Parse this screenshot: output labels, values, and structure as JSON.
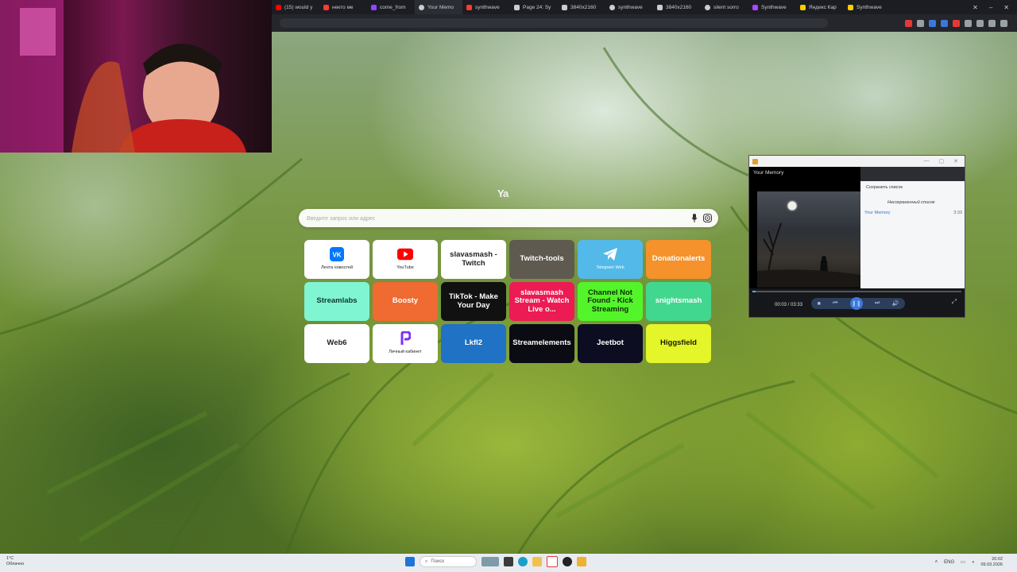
{
  "browser": {
    "tabs": [
      {
        "title": "(15) would y",
        "icon": "youtube-icon",
        "color": "#ff0000"
      },
      {
        "title": "некто ме",
        "icon": "yandex-music-icon",
        "color": "#ff3b30"
      },
      {
        "title": "come_from",
        "icon": "twitch-icon",
        "color": "#9146ff"
      },
      {
        "title": "Your Memo",
        "icon": "globe-icon",
        "color": "#cccccc"
      },
      {
        "title": "synthwave",
        "icon": "yandex-music-icon",
        "color": "#ff3b30"
      },
      {
        "title": "Page 24: Sy",
        "icon": "page-icon",
        "color": "#cccccc"
      },
      {
        "title": "3840x2160",
        "icon": "image-icon",
        "color": "#cccccc"
      },
      {
        "title": "synthwave",
        "icon": "globe-icon",
        "color": "#cccccc"
      },
      {
        "title": "3840x2160",
        "icon": "image-icon",
        "color": "#cccccc"
      },
      {
        "title": "silent sorro",
        "icon": "globe-icon",
        "color": "#cccccc"
      },
      {
        "title": "Synthwave",
        "icon": "synthwave-icon",
        "color": "#b046ff"
      },
      {
        "title": "Яндекс Кар",
        "icon": "yandex-icon",
        "color": "#ffcc00"
      },
      {
        "title": "Synthwave",
        "icon": "yandex-icon",
        "color": "#ffcc00"
      }
    ]
  },
  "search": {
    "logo": "Ya",
    "placeholder": "Введите запрос или адрес"
  },
  "tiles": [
    {
      "label": "",
      "caption": "Лента новостей",
      "icon": "vk-icon",
      "bg": "#ffffff",
      "fg": "#222222"
    },
    {
      "label": "",
      "caption": "YouTube",
      "icon": "youtube-icon",
      "bg": "#ffffff",
      "fg": "#222222"
    },
    {
      "label": "slavasmash - Twitch",
      "caption": "",
      "icon": "",
      "bg": "#ffffff",
      "fg": "#222222"
    },
    {
      "label": "Twitch-tools",
      "caption": "",
      "icon": "",
      "bg": "#5e5a50",
      "fg": "#ffffff"
    },
    {
      "label": "",
      "caption": "Telegram Web",
      "icon": "telegram-icon",
      "bg": "#53b9e8",
      "fg": "#ffffff"
    },
    {
      "label": "Donationalerts",
      "caption": "",
      "icon": "",
      "bg": "#f5922b",
      "fg": "#ffffff"
    },
    {
      "label": "Streamlabs",
      "caption": "",
      "icon": "",
      "bg": "#80f5d2",
      "fg": "#0d3a2e"
    },
    {
      "label": "Boosty",
      "caption": "",
      "icon": "",
      "bg": "#ef6b32",
      "fg": "#ffffff"
    },
    {
      "label": "TikTok - Make Your Day",
      "caption": "",
      "icon": "",
      "bg": "#111111",
      "fg": "#ffffff"
    },
    {
      "label": "slavasmash Stream - Watch Live o...",
      "caption": "",
      "icon": "",
      "bg": "#ec1b53",
      "fg": "#ffffff"
    },
    {
      "label": "Channel Not Found - Kick Streaming",
      "caption": "",
      "icon": "",
      "bg": "#53f52a",
      "fg": "#102a08"
    },
    {
      "label": "snightsmash",
      "caption": "",
      "icon": "",
      "bg": "#42d78e",
      "fg": "#ffffff"
    },
    {
      "label": "Web6",
      "caption": "",
      "icon": "",
      "bg": "#ffffff",
      "fg": "#222222"
    },
    {
      "label": "",
      "caption": "Личный кабинет",
      "icon": "lk-icon",
      "bg": "#ffffff",
      "fg": "#222222"
    },
    {
      "label": "Lkfl2",
      "caption": "",
      "icon": "",
      "bg": "#1f72c4",
      "fg": "#ffffff"
    },
    {
      "label": "Streamelements",
      "caption": "",
      "icon": "",
      "bg": "#0b0b14",
      "fg": "#ffffff"
    },
    {
      "label": "Jeetbot",
      "caption": "",
      "icon": "",
      "bg": "#0d0d22",
      "fg": "#ffffff"
    },
    {
      "label": "Higgsfield",
      "caption": "",
      "icon": "",
      "bg": "#e4f52a",
      "fg": "#1a1a00"
    }
  ],
  "player": {
    "track_title": "Your Memory",
    "save_list": "Сохранить список",
    "unsaved_list": "Несохраненный список",
    "playlist_item": "Your Memory",
    "playlist_duration": "3:33",
    "time": "00:03 / 03:33",
    "progress": 0.014
  },
  "taskbar": {
    "weather_temp": "1°C",
    "weather_desc": "Облачно",
    "search_label": "Поиск",
    "lang": "ENG",
    "time": "20:02",
    "date": "09.03.2026"
  }
}
